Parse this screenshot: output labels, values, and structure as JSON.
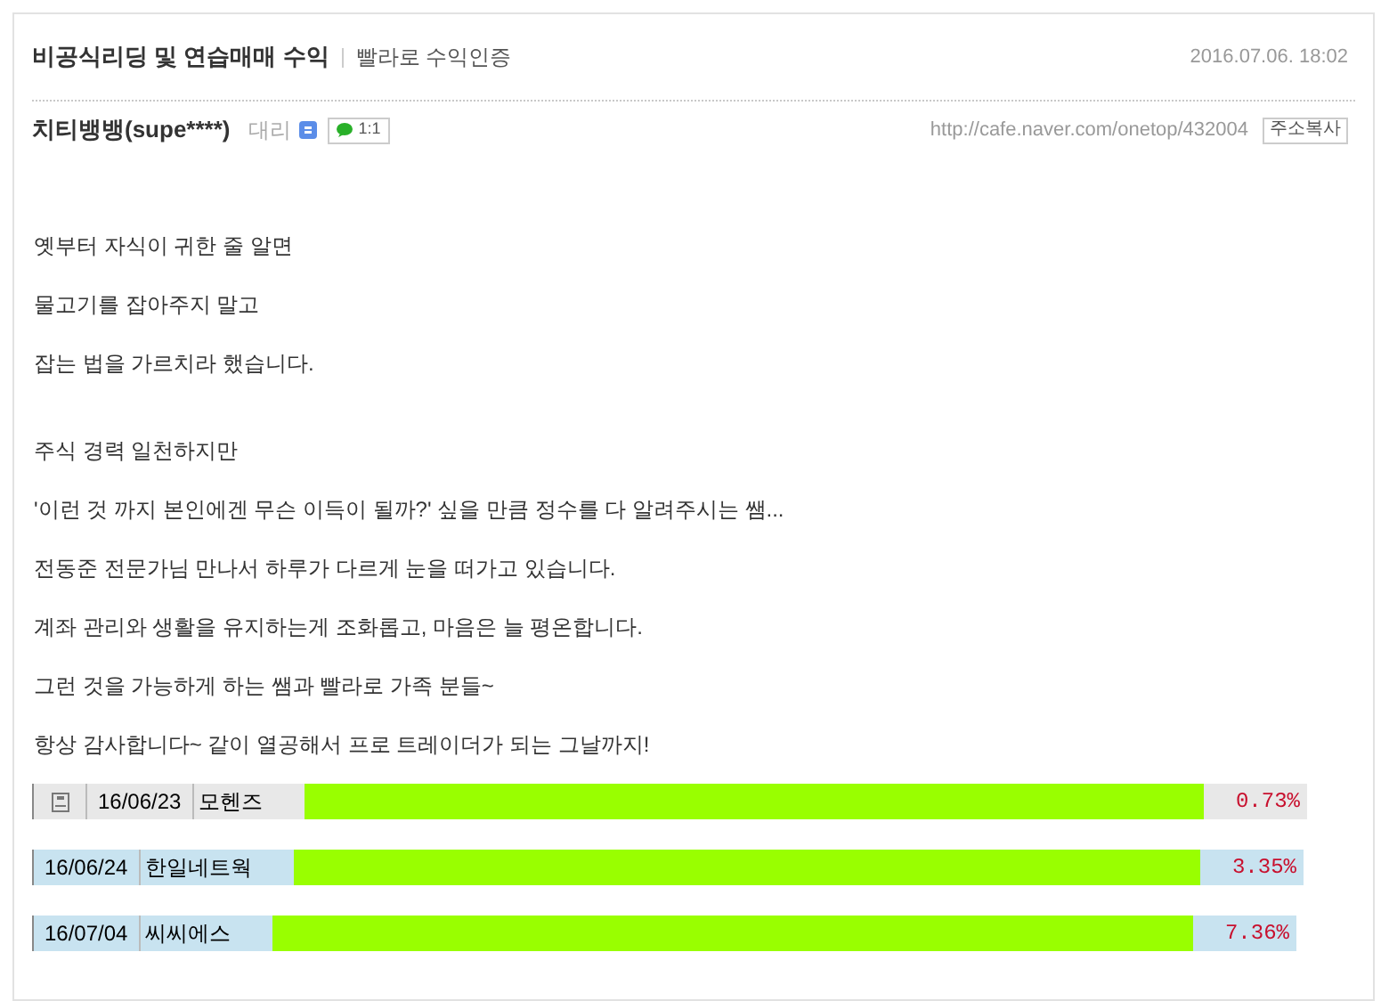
{
  "post": {
    "title": "비공식리딩 및 연습매매 수익",
    "category": "빨라로 수익인증",
    "date": "2016.07.06. 18:02",
    "author": "치티뱅뱅(supe****)",
    "rank": "대리",
    "chat_label": "1:1",
    "url": "http://cafe.naver.com/onetop/432004",
    "copy_button": "주소복사"
  },
  "paragraphs": [
    {
      "lines": [
        "옛부터 자식이 귀한 줄 알면",
        "물고기를 잡아주지 말고",
        "잡는 법을 가르치라 했습니다."
      ]
    },
    {
      "lines": [
        "주식 경력 일천하지만",
        "'이런 것 까지 본인에겐 무슨 이득이 될까?' 싶을 만큼 정수를 다 알려주시는 쌤...",
        "전동준 전문가님 만나서 하루가 다르게 눈을 떠가고 있습니다.",
        "계좌 관리와 생활을 유지하는게 조화롭고, 마음은 늘 평온합니다.",
        "그런 것을 가능하게 하는 쌤과 빨라로 가족 분들~",
        "항상 감사합니다~ 같이 열공해서 프로 트레이더가 되는 그날까지!"
      ]
    }
  ],
  "trades": [
    {
      "kind": "gray",
      "date": "16/06/23",
      "name": "모헨즈",
      "return": "0.73%"
    },
    {
      "kind": "blue",
      "date": "16/06/24",
      "name": "한일네트웍",
      "return": "3.35%"
    },
    {
      "kind": "blue",
      "date": "16/07/04",
      "name": "씨씨에스",
      "return": "7.36%"
    }
  ]
}
